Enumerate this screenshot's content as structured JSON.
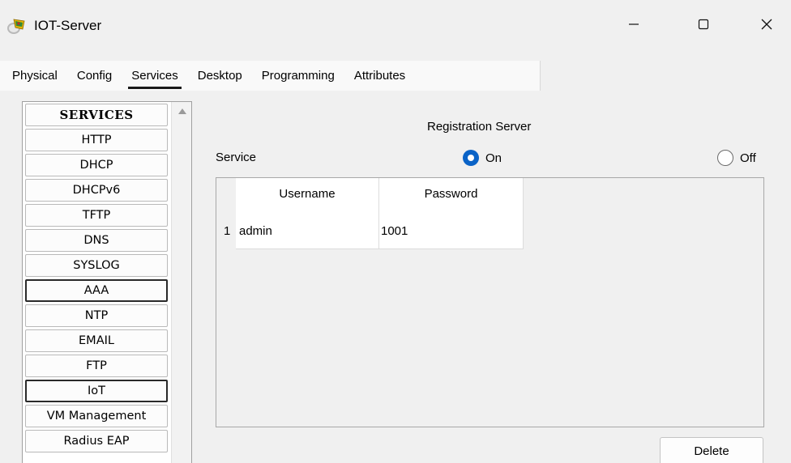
{
  "window": {
    "title": "IOT-Server",
    "icon": "iot-device-icon",
    "controls": [
      "minimize-icon",
      "maximize-icon",
      "close-icon"
    ]
  },
  "tabs": [
    {
      "label": "Physical",
      "active": false
    },
    {
      "label": "Config",
      "active": false
    },
    {
      "label": "Services",
      "active": true
    },
    {
      "label": "Desktop",
      "active": false
    },
    {
      "label": "Programming",
      "active": false
    },
    {
      "label": "Attributes",
      "active": false
    }
  ],
  "services": {
    "header": "SERVICES",
    "items": [
      "HTTP",
      "DHCP",
      "DHCPv6",
      "TFTP",
      "DNS",
      "SYSLOG",
      "AAA",
      "NTP",
      "EMAIL",
      "FTP",
      "IoT",
      "VM Management",
      "Radius EAP"
    ],
    "highlighted": [
      "AAA",
      "IoT"
    ]
  },
  "registration": {
    "title": "Registration Server",
    "service_label": "Service",
    "on_label": "On",
    "off_label": "Off",
    "selected": "On",
    "accent": "#0a63c7"
  },
  "table": {
    "columns": [
      "Username",
      "Password"
    ],
    "rows": [
      {
        "index": "1",
        "username": "admin",
        "password": "1001"
      }
    ]
  },
  "delete_label": "Delete"
}
